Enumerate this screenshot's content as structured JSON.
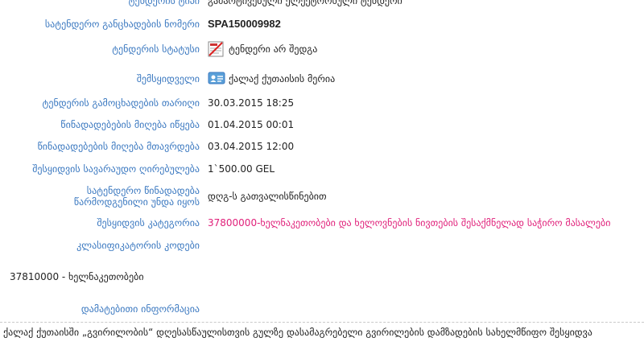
{
  "tender_type": {
    "label": "ტენდერის ტიპი",
    "value": "გამარტივებული ელექტრონული ტენდერი"
  },
  "announcement_number": {
    "label": "სატენდერო განცხადების ნომერი",
    "value": "SPA150009982"
  },
  "tender_status": {
    "label": "ტენდერის სტატუსი",
    "icon": "tender-failed-icon",
    "value": "ტენდერი არ შედგა"
  },
  "purchaser": {
    "label": "შემსყიდველი",
    "icon": "organization-card-icon",
    "value": "ქალაქ ქუთაისის მერია"
  },
  "announcement_date": {
    "label": "ტენდერის გამოცხადების თარიღი",
    "value": "30.03.2015 18:25"
  },
  "bids_start": {
    "label": "წინადადებების მიღება იწყება",
    "value": "01.04.2015 00:01"
  },
  "bids_end": {
    "label": "წინადადებების მიღება მთავრდება",
    "value": "03.04.2015 12:00"
  },
  "estimated_value": {
    "label": "შესყიდვის სავარაუდო ღირებულება",
    "value": "1`500.00 GEL"
  },
  "proposal_presentation": {
    "label_line1": "სატენდერო წინადადება",
    "label_line2": "წარმოდგენილი უნდა იყოს",
    "value": "დღგ-ს გათვალისწინებით"
  },
  "category": {
    "label": "შესყიდვის კატეგორია",
    "value": "37800000-ხელნაკეთობები და ხელოვნების ნივთების შესაქმნელად საჭირო მასალები"
  },
  "classifier_codes": {
    "label": "კლასიფიკატორის კოდები",
    "code": "37810000 - ხელნაკეთობები"
  },
  "additional_info": {
    "label": "დამატებითი ინფორმაცია",
    "text": "ქალაქ ქუთაისში „გვირილობის“ დღესასწაულისთვის გულზე დასამაგრებელი გვირილების დამზადების სახელმწიფო შესყიდვა"
  },
  "colors": {
    "label": "#3a78c0",
    "category": "#e0207a",
    "text": "#222222"
  }
}
